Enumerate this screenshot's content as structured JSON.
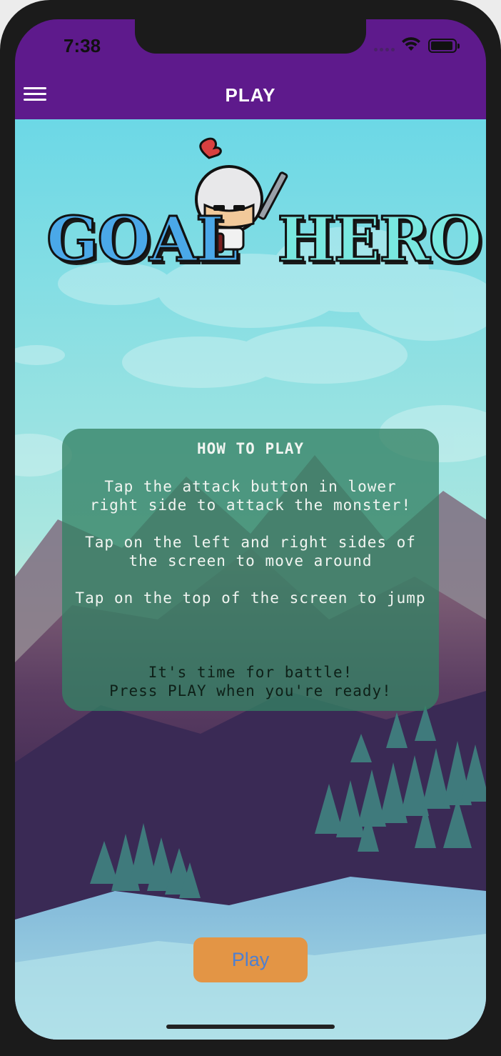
{
  "status_bar": {
    "time": "7:38"
  },
  "nav": {
    "title": "PLAY",
    "menu_icon": "hamburger-menu-icon"
  },
  "logo": {
    "word_1": "GOAL",
    "word_2": "HERO"
  },
  "how_to_play": {
    "title": "HOW TO PLAY",
    "attack_line_1": "Tap the attack button in lower",
    "attack_line_2": "right side to attack the monster!",
    "move_line_1": "Tap on the left and right sides of",
    "move_line_2": "the screen to move around",
    "jump_line": "Tap on the top of the screen to jump",
    "battle_line_1": "It's time for battle!",
    "battle_line_2": "Press PLAY when you're ready!"
  },
  "play_button": {
    "label": "Play"
  },
  "colors": {
    "nav_background": "#5e1a8c",
    "card_background": "#358264",
    "play_button": "#e39545",
    "play_button_text": "#4e7fd0"
  }
}
